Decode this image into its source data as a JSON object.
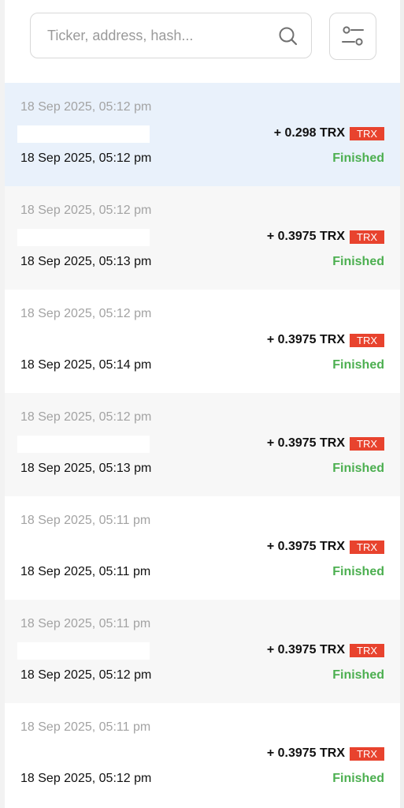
{
  "search": {
    "placeholder": "Ticker, address, hash...",
    "value": ""
  },
  "icons": {
    "search": "search-icon",
    "filter": "filter-sliders-icon"
  },
  "colors": {
    "accent_badge": "#e8432e",
    "status_finished": "#4caf50",
    "selected_row": "#e9f1fb"
  },
  "transactions": [
    {
      "time": "18 Sep 2025, 05:12 pm",
      "amount": "+ 0.298 TRX",
      "token": "TRX",
      "completed_time": "18 Sep 2025, 05:12 pm",
      "status": "Finished"
    },
    {
      "time": "18 Sep 2025, 05:12 pm",
      "amount": "+ 0.3975 TRX",
      "token": "TRX",
      "completed_time": "18 Sep 2025, 05:13 pm",
      "status": "Finished"
    },
    {
      "time": "18 Sep 2025, 05:12 pm",
      "amount": "+ 0.3975 TRX",
      "token": "TRX",
      "completed_time": "18 Sep 2025, 05:14 pm",
      "status": "Finished"
    },
    {
      "time": "18 Sep 2025, 05:12 pm",
      "amount": "+ 0.3975 TRX",
      "token": "TRX",
      "completed_time": "18 Sep 2025, 05:13 pm",
      "status": "Finished"
    },
    {
      "time": "18 Sep 2025, 05:11 pm",
      "amount": "+ 0.3975 TRX",
      "token": "TRX",
      "completed_time": "18 Sep 2025, 05:11 pm",
      "status": "Finished"
    },
    {
      "time": "18 Sep 2025, 05:11 pm",
      "amount": "+ 0.3975 TRX",
      "token": "TRX",
      "completed_time": "18 Sep 2025, 05:12 pm",
      "status": "Finished"
    },
    {
      "time": "18 Sep 2025, 05:11 pm",
      "amount": "+ 0.3975 TRX",
      "token": "TRX",
      "completed_time": "18 Sep 2025, 05:12 pm",
      "status": "Finished"
    }
  ]
}
